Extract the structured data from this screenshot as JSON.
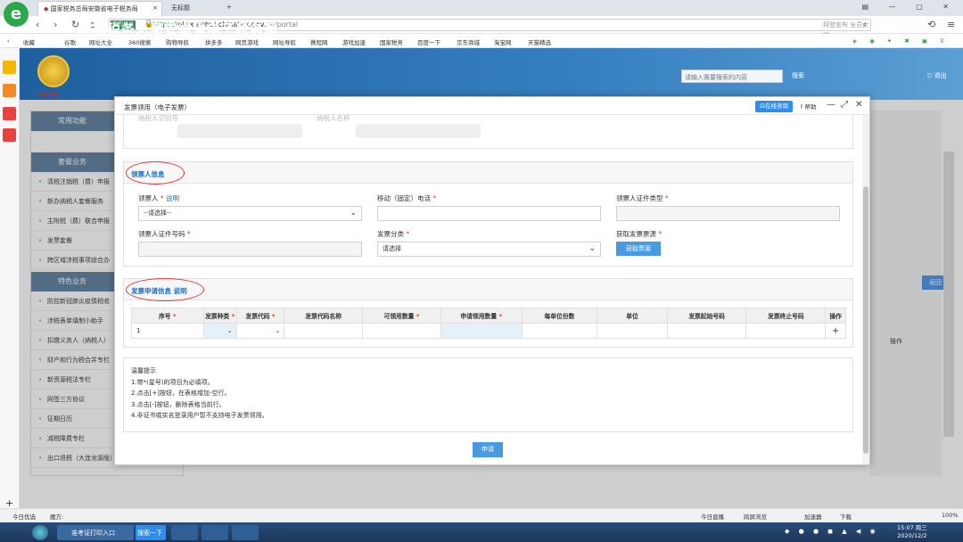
{
  "browser": {
    "tabs": [
      {
        "label": "国家税务总局安徽省电子税务局"
      },
      {
        "label": "无标题"
      }
    ],
    "security_badge": "我的机关",
    "url_scheme": "https://",
    "url_host": "etax.anhui.chinatax.gov.cn",
    "url_path": "/portal",
    "search_hint": "拜登宣布 全员女将",
    "bookmarks": [
      "收藏",
      "谷歌",
      "网址大全",
      "360搜索",
      "购物导航",
      "拼多多",
      "网页游戏",
      "网址导航",
      "携程网",
      "游戏加速",
      "国家税务",
      "百度一下",
      "京东商城",
      "淘宝网",
      "天猫精选"
    ]
  },
  "portal": {
    "site_title": "国家税务总局安徽省电子税务局",
    "emblem_caption": "中国税务",
    "search_placeholder": "请输入需要搜索的内容",
    "search_btn": "搜索",
    "logout": "退出",
    "sidebar": {
      "header1": "常用功能",
      "header2": "套餐业务",
      "items_a": [
        "清税注销税（费）申报",
        "新办纳税人套餐服务",
        "主附税（费）联合申报",
        "发票套餐",
        "跨区域涉税事项综合办"
      ],
      "header3": "特色业务",
      "items_b": [
        "防控新冠肺炎疫情税收",
        "涉税表单填制小助手",
        "扣缴义务人（纳税人）",
        "财产和行为税合并专栏",
        "新资源税法专栏",
        "网签三方协议",
        "征期日历",
        "减税降费专栏",
        "出口退税（大连龙源版）"
      ]
    },
    "back_btn": "返回",
    "op_col": "操作"
  },
  "modal": {
    "title": "发票领用（电子发票）",
    "consult_btn": "在线咨询",
    "help": "帮助",
    "top_labels": [
      "纳税人识别号",
      "纳税人名称"
    ],
    "receiver": {
      "section_title": "领票人信息",
      "name_label": "领票人",
      "name_help": "说明",
      "name_select": "--请选择--",
      "phone_label": "移动（固定）电话",
      "idtype_label": "领票人证件类型",
      "idno_label": "领票人证件号码",
      "category_label": "发票分类",
      "category_select": "请选择",
      "source_label": "获取发票票源",
      "source_btn": "获取票源"
    },
    "apply": {
      "section_title": "发票申请信息",
      "section_help": "说明",
      "columns": [
        "序号",
        "发票种类",
        "发票代码",
        "发票代码名称",
        "可领用数量",
        "申请领用数量",
        "每单位份数",
        "单位",
        "发票起始号码",
        "发票终止号码",
        "操作"
      ],
      "rows": [
        {
          "no": "1"
        }
      ],
      "add_icon": "+"
    },
    "tips": {
      "title": "温馨提示",
      "lines": [
        "1.带*(星号)的项目为必填项。",
        "2.点击[+]按钮，在表格增加-空行。",
        "3.点击[-]按钮，删除表格当前行。",
        "4.非证书或实名登录用户暂不支持电子发票领用。"
      ]
    },
    "submit": "申请"
  },
  "os": {
    "status_left": [
      "今日优选",
      "魔方:"
    ],
    "status_right": [
      "今日直播",
      "跨屏浏览",
      "加速器",
      "下载",
      "100%"
    ],
    "taskbar_items": [
      "准考证打印入口",
      "搜索一下"
    ],
    "clock_time": "15:07 周三",
    "clock_date": "2020/12/2"
  }
}
